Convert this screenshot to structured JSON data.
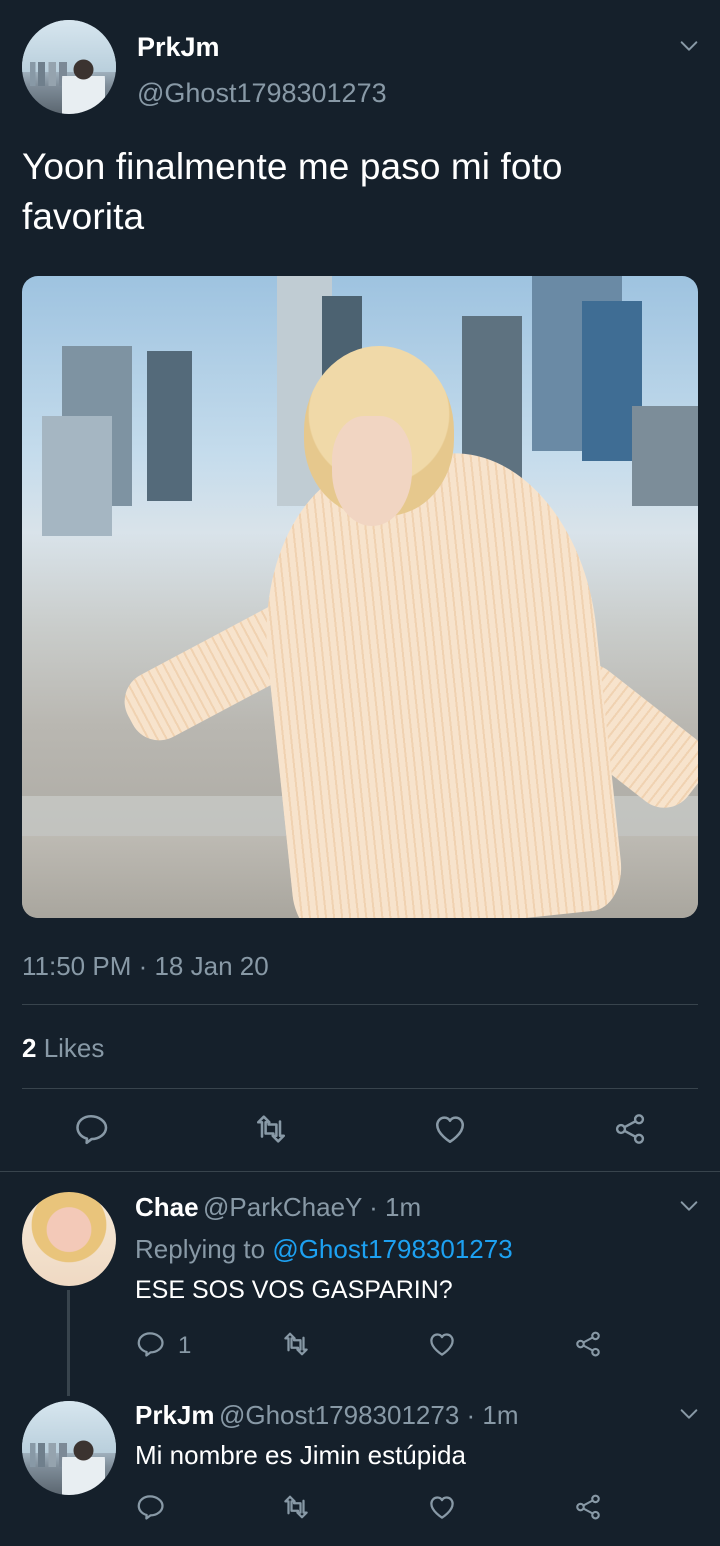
{
  "main_tweet": {
    "author_name": "PrkJm",
    "author_handle": "@Ghost1798301273",
    "text": "Yoon finalmente me paso mi foto favorita",
    "timestamp": "11:50 PM · 18 Jan 20",
    "likes_count": "2",
    "likes_label": " Likes"
  },
  "replies": [
    {
      "author_name": "Chae",
      "author_handle": "@ParkChaeY",
      "time": " · 1m",
      "replying_prefix": "Replying to ",
      "replying_to": "@Ghost1798301273",
      "text": "ESE SOS VOS GASPARIN?",
      "reply_count": "1"
    },
    {
      "author_name": "PrkJm",
      "author_handle": "@Ghost1798301273",
      "time": " · 1m",
      "text": "Mi nombre es Jimin estúpida"
    }
  ],
  "colors": {
    "background": "#15202b",
    "secondary_text": "#8899a6",
    "link": "#1da1f2",
    "divider": "#38444d"
  },
  "icons": {
    "reply": "reply-icon",
    "retweet": "retweet-icon",
    "like": "heart-icon",
    "share": "share-icon",
    "more": "chevron-down-icon"
  }
}
